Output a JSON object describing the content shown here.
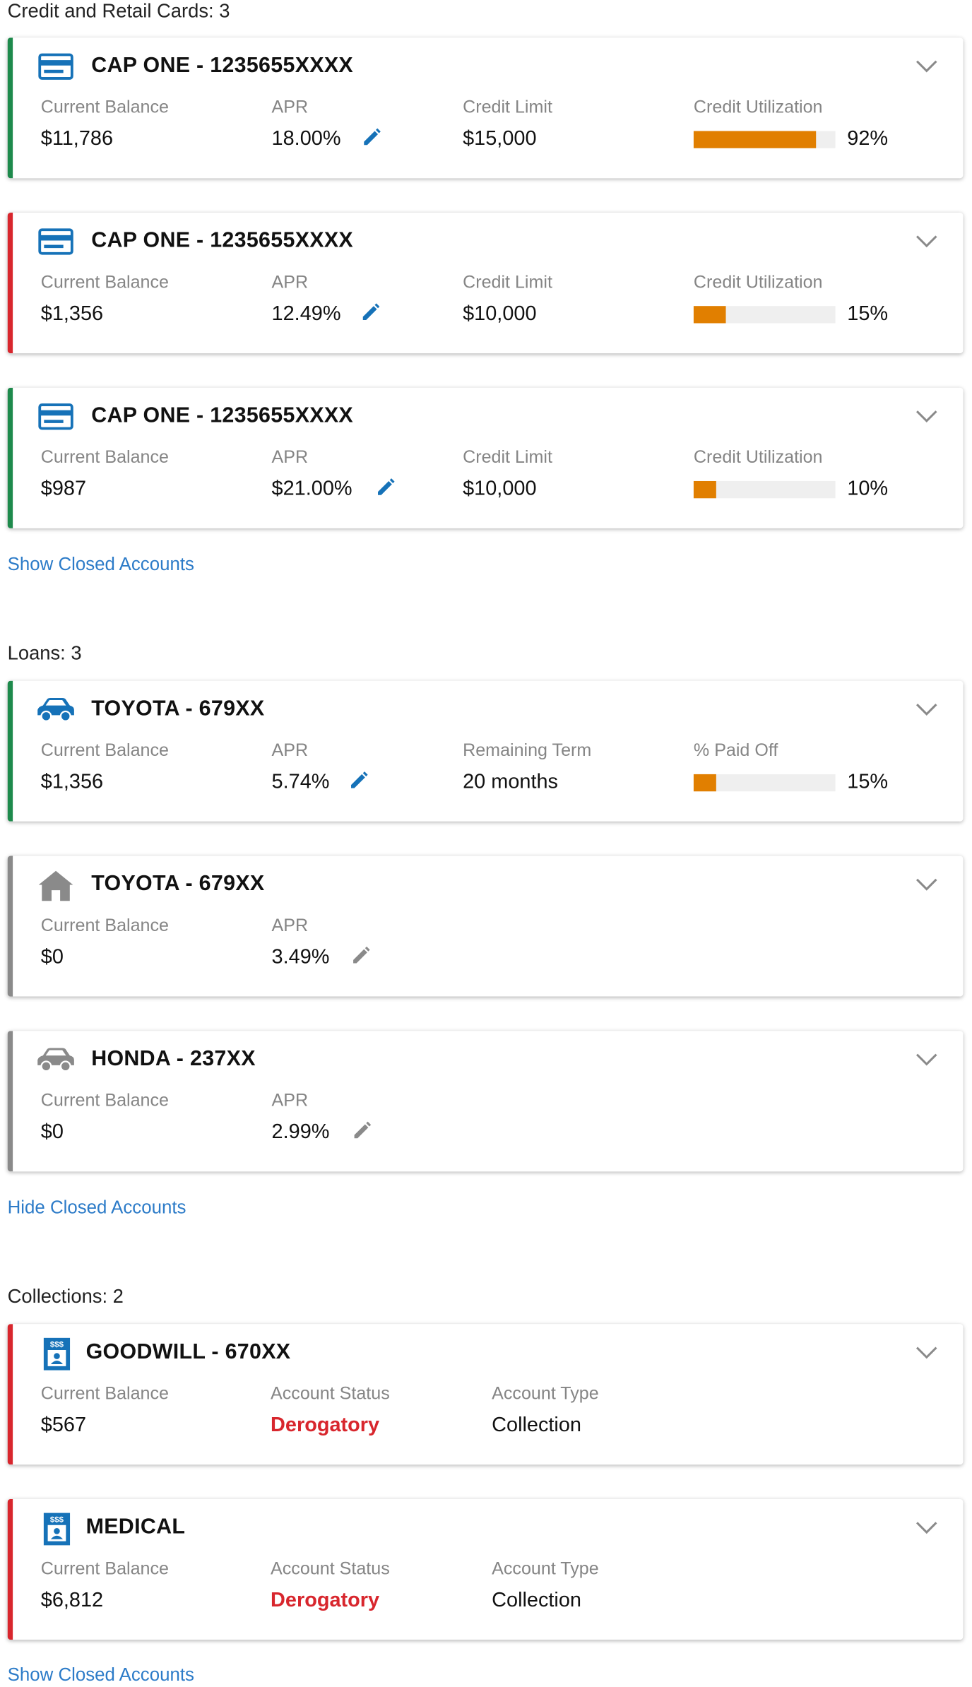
{
  "colors": {
    "accent_blue": "#1672b8",
    "link_blue": "#2c7bc8",
    "open_good": "#1e8a4c",
    "alert_red": "#d8262d",
    "closed_gray": "#8a8a8a",
    "bar_orange": "#e17f00",
    "bar_track": "#efefef"
  },
  "credit_section": {
    "title": "Credit and Retail Cards: 3",
    "toggle_link": "Show Closed Accounts",
    "cards": [
      {
        "icon": "credit-card-icon",
        "status": "green",
        "title": "CAP ONE - 1235655XXXX",
        "balance_label": "Current Balance",
        "balance": "$11,786",
        "apr_label": "APR",
        "apr": "18.00%",
        "limit_label": "Credit Limit",
        "limit": "$15,000",
        "util_label": "Credit Utilization",
        "util_text": "92%",
        "util_fraction": 0.86
      },
      {
        "icon": "credit-card-icon",
        "status": "red",
        "title": "CAP ONE - 1235655XXXX",
        "balance_label": "Current Balance",
        "balance": "$1,356",
        "apr_label": "APR",
        "apr": "12.49%",
        "limit_label": "Credit Limit",
        "limit": "$10,000",
        "util_label": "Credit Utilization",
        "util_text": "15%",
        "util_fraction": 0.23
      },
      {
        "icon": "credit-card-icon",
        "status": "green",
        "title": "CAP ONE - 1235655XXXX",
        "balance_label": "Current Balance",
        "balance": "$987",
        "apr_label": "APR",
        "apr": "$21.00%",
        "limit_label": "Credit Limit",
        "limit": "$10,000",
        "util_label": "Credit Utilization",
        "util_text": "10%",
        "util_fraction": 0.16
      }
    ]
  },
  "loans_section": {
    "title": "Loans: 3",
    "toggle_link": "Hide Closed Accounts",
    "cards": [
      {
        "icon": "car-icon",
        "status": "green",
        "title": "TOYOTA - 679XX",
        "balance_label": "Current Balance",
        "balance": "$1,356",
        "apr_label": "APR",
        "apr": "5.74%",
        "term_label": "Remaining Term",
        "term": "20 months",
        "paid_label": "% Paid Off",
        "paid_text": "15%",
        "paid_fraction": 0.16
      },
      {
        "icon": "house-icon",
        "status": "gray",
        "title": "TOYOTA - 679XX",
        "balance_label": "Current Balance",
        "balance": "$0",
        "apr_label": "APR",
        "apr": "3.49%"
      },
      {
        "icon": "car-icon",
        "status": "gray",
        "title": "HONDA - 237XX",
        "balance_label": "Current Balance",
        "balance": "$0",
        "apr_label": "APR",
        "apr": "2.99%"
      }
    ]
  },
  "collections_section": {
    "title": "Collections: 2",
    "toggle_link": "Show Closed Accounts",
    "cards": [
      {
        "icon": "collection-document-icon",
        "icon_text": "$$$",
        "status": "red",
        "title": "GOODWILL - 670XX",
        "balance_label": "Current Balance",
        "balance": "$567",
        "status_label": "Account Status",
        "status_value": "Derogatory",
        "type_label": "Account Type",
        "type_value": "Collection"
      },
      {
        "icon": "collection-document-icon",
        "icon_text": "$$$",
        "status": "red",
        "title": "MEDICAL",
        "balance_label": "Current Balance",
        "balance": "$6,812",
        "status_label": "Account Status",
        "status_value": "Derogatory",
        "type_label": "Account Type",
        "type_value": "Collection"
      }
    ]
  }
}
